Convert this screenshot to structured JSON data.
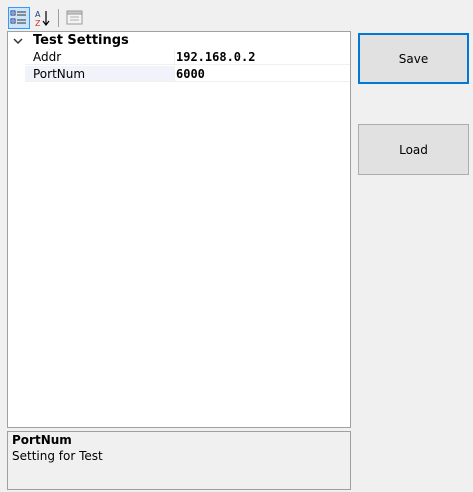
{
  "toolbar": {
    "categorized_icon": "categorized-view-icon",
    "alphabetical_icon": "alphabetical-sort-icon",
    "property_pages_icon": "property-pages-icon"
  },
  "grid": {
    "category": {
      "label": "Test Settings",
      "expanded": true
    },
    "properties": [
      {
        "name": "Addr",
        "value": "192.168.0.2"
      },
      {
        "name": "PortNum",
        "value": "6000"
      }
    ],
    "selected_property": "PortNum"
  },
  "description": {
    "title": "PortNum",
    "text": "Setting for Test"
  },
  "buttons": {
    "save_label": "Save",
    "load_label": "Load"
  },
  "colors": {
    "focus_border": "#0078d7",
    "selected_toolbar_bg": "#cce4f7"
  }
}
